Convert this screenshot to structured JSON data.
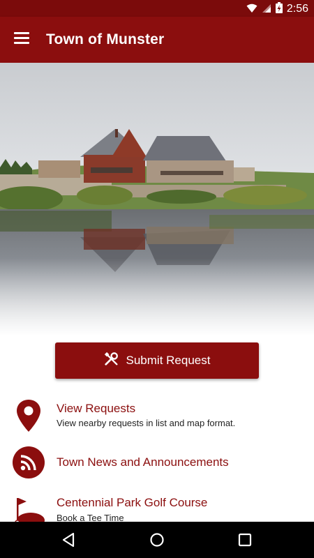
{
  "status_bar": {
    "time": "2:56",
    "icons": [
      "wifi-icon",
      "signal-icon",
      "battery-charging-icon"
    ]
  },
  "app_bar": {
    "title": "Town of Munster",
    "menu_icon": "hamburger-menu-icon"
  },
  "hero": {
    "description_icon": "town-hall-lake-photo"
  },
  "submit_button": {
    "label": "Submit Request",
    "icon": "tools-icon"
  },
  "menu_items": [
    {
      "title": "View Requests",
      "subtitle": "View nearby requests in list and map format.",
      "icon": "map-pin-icon"
    },
    {
      "title": "Town News and Announcements",
      "subtitle": "",
      "icon": "rss-feed-icon"
    },
    {
      "title": "Centennial Park Golf Course",
      "subtitle": "Book a Tee Time",
      "icon": "golf-flag-icon"
    }
  ],
  "nav_bar": {
    "buttons": [
      "back-icon",
      "home-icon",
      "recents-icon"
    ]
  },
  "colors": {
    "primary": "#8b0e0e",
    "status_bar": "#7b0b0b",
    "background": "#ffffff"
  }
}
